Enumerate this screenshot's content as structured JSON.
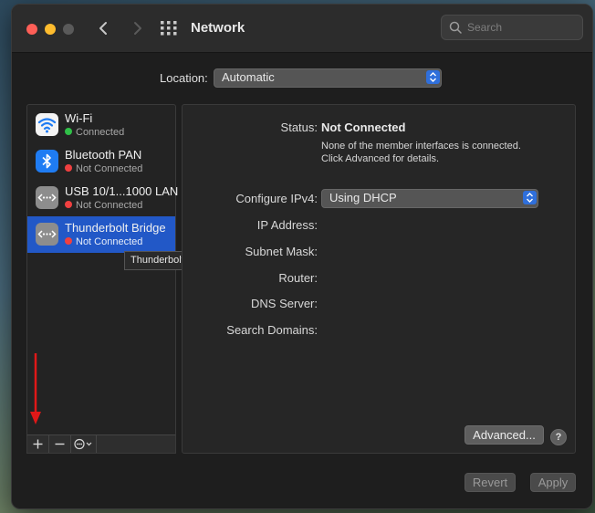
{
  "window": {
    "title": "Network",
    "search_placeholder": "Search"
  },
  "location": {
    "label": "Location:",
    "value": "Automatic"
  },
  "services": [
    {
      "name": "Wi-Fi",
      "status": "Connected",
      "status_color": "#30c048",
      "icon": "wifi-icon"
    },
    {
      "name": "Bluetooth PAN",
      "status": "Not Connected",
      "status_color": "#f04040",
      "icon": "bluetooth-icon"
    },
    {
      "name": "USB 10/1...1000 LAN",
      "status": "Not Connected",
      "status_color": "#f04040",
      "icon": "ethernet-icon"
    },
    {
      "name": "Thunderbolt Bridge",
      "status": "Not Connected",
      "status_color": "#f04040",
      "icon": "ethernet-icon",
      "selected": true
    }
  ],
  "tooltip": "Thunderbolt Bridge",
  "detail": {
    "status_label": "Status:",
    "status_value": "Not Connected",
    "status_desc_1": "None of the member interfaces is connected.",
    "status_desc_2": "Click Advanced for details.",
    "configure_label": "Configure IPv4:",
    "configure_value": "Using DHCP",
    "ip_label": "IP Address:",
    "subnet_label": "Subnet Mask:",
    "router_label": "Router:",
    "dns_label": "DNS Server:",
    "search_domains_label": "Search Domains:"
  },
  "buttons": {
    "advanced": "Advanced...",
    "help": "?",
    "revert": "Revert",
    "apply": "Apply"
  },
  "toolbar": {
    "add": "+",
    "remove": "−"
  },
  "colors": {
    "selection": "#2258c7",
    "accent": "#2f6fdb",
    "annotation_arrow": "#e01818"
  }
}
